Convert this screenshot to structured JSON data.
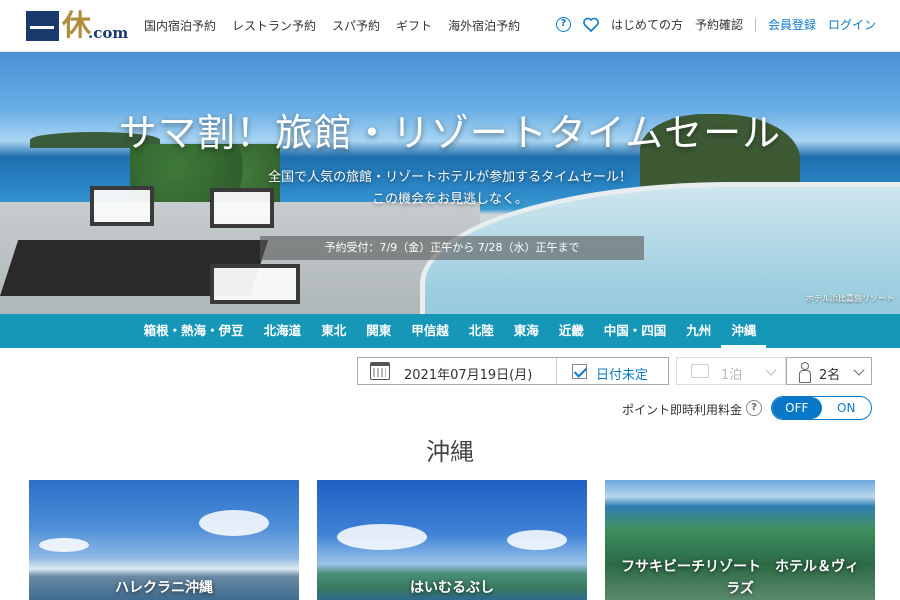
{
  "header": {
    "logo_text": "一休",
    "logo_suffix": ".com",
    "nav": [
      "国内宿泊予約",
      "レストラン予約",
      "スパ予約",
      "ギフト",
      "海外宿泊予約"
    ],
    "help_icon": "question-circle-icon",
    "favorite_icon": "heart-icon",
    "beginner": "はじめての方",
    "reservation_check": "予約確認",
    "register": "会員登録",
    "login": "ログイン",
    "accent_color": "#0a78c8"
  },
  "hero": {
    "title": "サマ割！旅館・リゾートタイムセール",
    "subtitle_line1": "全国で人気の旅館・リゾートホテルが参加するタイムセール！",
    "subtitle_line2": "この機会をお見逃しなく。",
    "period": "予約受付：7/9（金）正午から 7/28（水）正午まで",
    "credit": "ホテル浜比嘉島リゾート"
  },
  "regions": {
    "items": [
      "箱根・熱海・伊豆",
      "北海道",
      "東北",
      "関東",
      "甲信越",
      "北陸",
      "東海",
      "近畿",
      "中国・四国",
      "九州",
      "沖縄"
    ],
    "active": "沖縄",
    "bar_color": "#1697b8"
  },
  "search": {
    "date": "2021年07月19日(月)",
    "date_undecided": "日付未定",
    "date_undecided_checked": true,
    "nights": "1泊",
    "guests": "2名",
    "points_label": "ポイント即時利用料金",
    "toggle_off": "OFF",
    "toggle_on": "ON",
    "toggle_state": "OFF"
  },
  "section": {
    "title": "沖縄"
  },
  "cards": [
    {
      "name": "ハレクラニ沖縄"
    },
    {
      "name": "はいむるぶし"
    },
    {
      "name": "フサキビーチリゾート　ホテル＆ヴィラズ"
    }
  ]
}
